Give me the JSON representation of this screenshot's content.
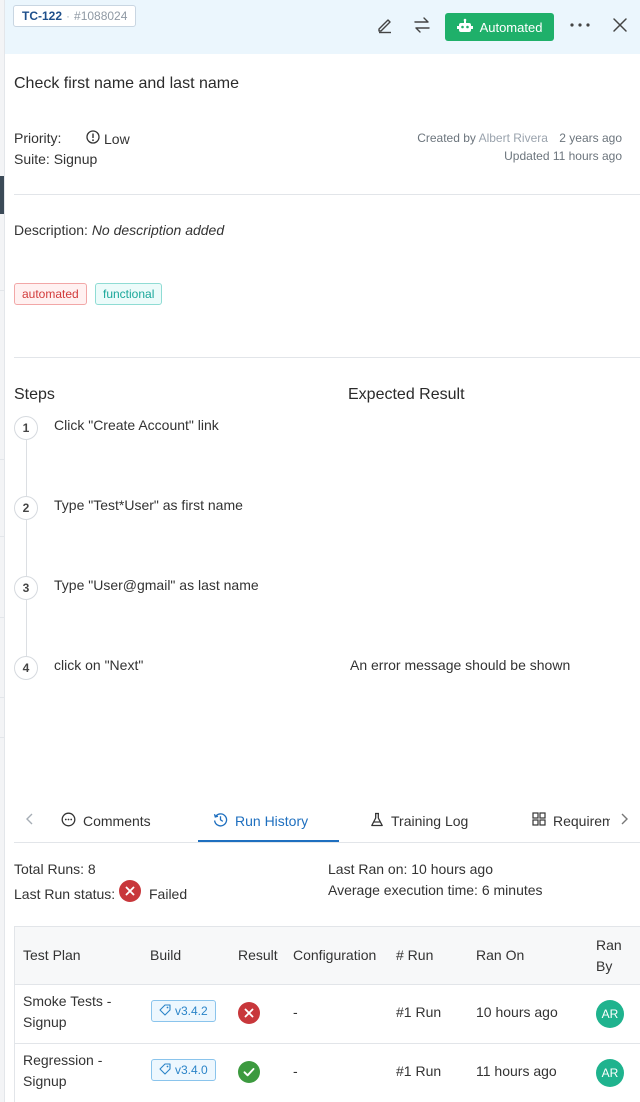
{
  "header": {
    "case_key": "TC-122",
    "case_sep": "·",
    "case_number": "#1088024",
    "automated_label": "Automated",
    "icons": [
      "edit-icon",
      "swap-icon",
      "robot-icon",
      "more-icon",
      "close-icon"
    ]
  },
  "title": "Check first name and last name",
  "meta": {
    "priority_label": "Priority:",
    "priority_value": "Low",
    "suite_label": "Suite: Signup",
    "created_prefix": "Created by",
    "created_by": "Albert Rivera",
    "created_ago": "2 years ago",
    "updated": "Updated 11 hours ago"
  },
  "description": {
    "label": "Description:",
    "value": "No description added"
  },
  "tags": [
    "automated",
    "functional"
  ],
  "steps_section": {
    "steps_heading": "Steps",
    "expected_heading": "Expected Result",
    "steps": [
      {
        "num": "1",
        "text": "Click \"Create Account\" link",
        "expected": ""
      },
      {
        "num": "2",
        "text": "Type \"Test*User\" as first name",
        "expected": ""
      },
      {
        "num": "3",
        "text": "Type \"User@gmail\" as last name",
        "expected": ""
      },
      {
        "num": "4",
        "text": "click on \"Next\"",
        "expected": "An error message should be shown"
      }
    ]
  },
  "tabs": [
    {
      "label": "Comments",
      "icon": "comment-icon",
      "active": false
    },
    {
      "label": "Run History",
      "icon": "history-icon",
      "active": true
    },
    {
      "label": "Training Log",
      "icon": "flask-icon",
      "active": false
    },
    {
      "label": "Requirem",
      "icon": "grid-icon",
      "active": false
    }
  ],
  "run_stats": {
    "total_runs": "Total Runs: 8",
    "last_run_status_label": "Last Run status:",
    "last_run_status": "Failed",
    "last_ran_on": "Last Ran on: 10 hours ago",
    "avg_time": "Average execution time: 6 minutes"
  },
  "table": {
    "columns": [
      "Test Plan",
      "Build",
      "Result",
      "Configuration",
      "# Run",
      "Ran On",
      "Ran",
      "By"
    ],
    "rows": [
      {
        "plan_line1": "Smoke Tests -",
        "plan_line2": "Signup",
        "build": "v3.4.2",
        "result": "failed",
        "configuration": "-",
        "run": "#1 Run",
        "ran_on": "10 hours ago",
        "by": "AR"
      },
      {
        "plan_line1": "Regression -",
        "plan_line2": "Signup",
        "build": "v3.4.0",
        "result": "passed",
        "configuration": "-",
        "run": "#1 Run",
        "ran_on": "11 hours ago",
        "by": "AR"
      }
    ]
  },
  "colors": {
    "accent": "#1e6fbf",
    "automated_green": "#1fb06a",
    "failed_red": "#c8373b",
    "passed_green": "#3c9a3f",
    "avatar": "#1fb38e"
  }
}
